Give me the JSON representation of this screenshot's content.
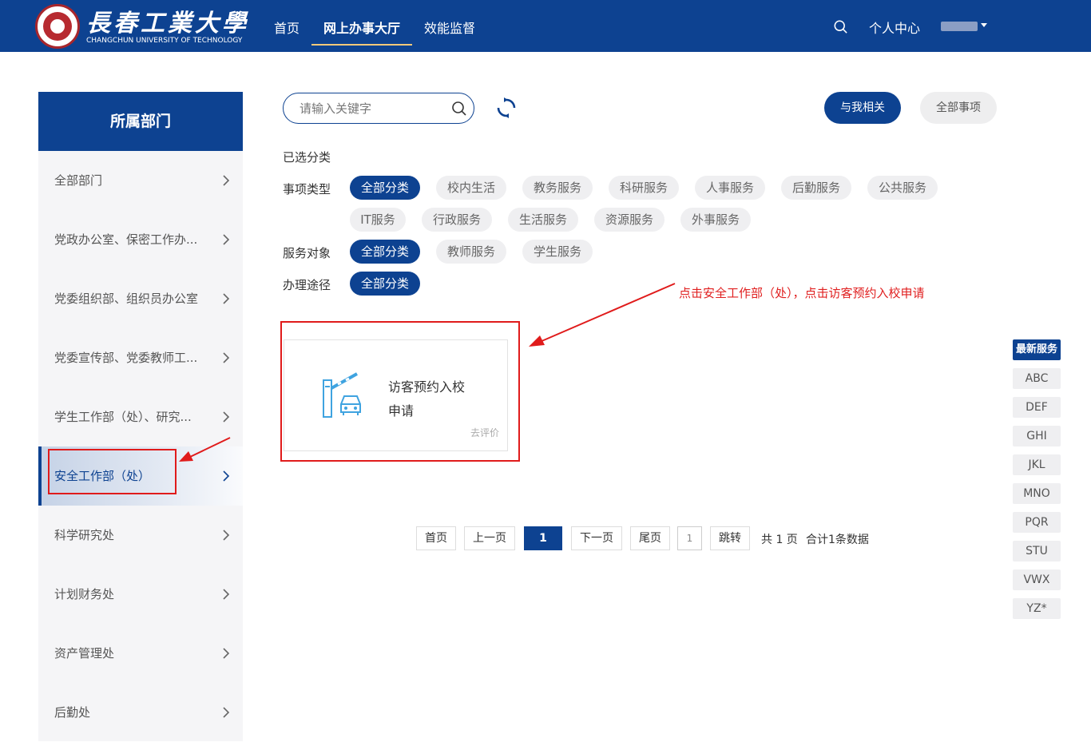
{
  "header": {
    "logo_cn": "長春工業大學",
    "logo_en": "CHANGCHUN UNIVERSITY OF TECHNOLOGY",
    "nav": [
      "首页",
      "网上办事大厅",
      "效能监督"
    ],
    "active_nav": "网上办事大厅",
    "user_center": "个人中心"
  },
  "sidebar": {
    "title": "所属部门",
    "items": [
      "全部部门",
      "党政办公室、保密工作办...",
      "党委组织部、组织员办公室",
      "党委宣传部、党委教师工...",
      "学生工作部（处）、研究...",
      "安全工作部（处）",
      "科学研究处",
      "计划财务处",
      "资产管理处",
      "后勤处"
    ],
    "active": "安全工作部（处）"
  },
  "search": {
    "placeholder": "请输入关键字"
  },
  "toolbar": {
    "related_label": "与我相关",
    "all_label": "全部事项"
  },
  "filters": {
    "selected_label": "已选分类",
    "type_label": "事项类型",
    "type_tags": [
      "全部分类",
      "校内生活",
      "教务服务",
      "科研服务",
      "人事服务",
      "后勤服务",
      "公共服务",
      "IT服务",
      "行政服务",
      "生活服务",
      "资源服务",
      "外事服务"
    ],
    "target_label": "服务对象",
    "target_tags": [
      "全部分类",
      "教师服务",
      "学生服务"
    ],
    "channel_label": "办理途径",
    "channel_tags": [
      "全部分类"
    ]
  },
  "annotation": "点击安全工作部（处），点击访客预约入校申请",
  "card": {
    "title": "访客预约入校申请",
    "rate": "去评价",
    "icon": "barrier-gate-car-icon"
  },
  "pagination": {
    "first": "首页",
    "prev": "上一页",
    "current": "1",
    "next": "下一页",
    "last": "尾页",
    "input_value": "1",
    "jump": "跳转",
    "total_pages": "共 1 页",
    "total_records": "合计1条数据"
  },
  "alpha_index": [
    "最新服务",
    "ABC",
    "DEF",
    "GHI",
    "JKL",
    "MNO",
    "PQR",
    "STU",
    "VWX",
    "YZ*"
  ],
  "colors": {
    "brand": "#0d4291",
    "annotation": "#e01b1b"
  }
}
